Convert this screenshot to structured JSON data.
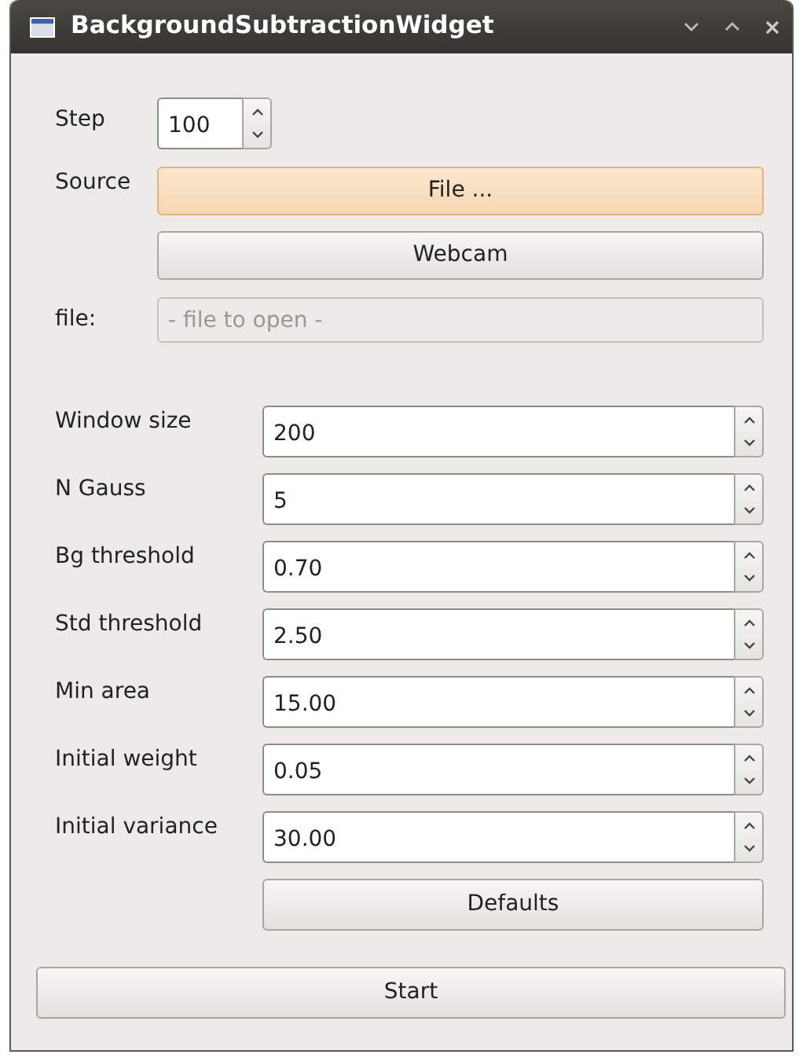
{
  "window": {
    "title": "BackgroundSubtractionWidget"
  },
  "step": {
    "label": "Step",
    "value": "100"
  },
  "source": {
    "label": "Source",
    "buttons": [
      {
        "label": "File ...",
        "highlighted": true
      },
      {
        "label": "Webcam",
        "highlighted": false
      }
    ]
  },
  "file": {
    "label": "file:",
    "placeholder": "- file to open -",
    "disabled": true
  },
  "parameters": [
    {
      "label": "Window size",
      "value": "200"
    },
    {
      "label": "N Gauss",
      "value": "5"
    },
    {
      "label": "Bg threshold",
      "value": "0.70"
    },
    {
      "label": "Std threshold",
      "value": "2.50"
    },
    {
      "label": "Min area",
      "value": "15.00"
    },
    {
      "label": "Initial weight",
      "value": "0.05"
    },
    {
      "label": "Initial variance",
      "value": "30.00"
    }
  ],
  "defaults_button": "Defaults",
  "start_button": "Start"
}
